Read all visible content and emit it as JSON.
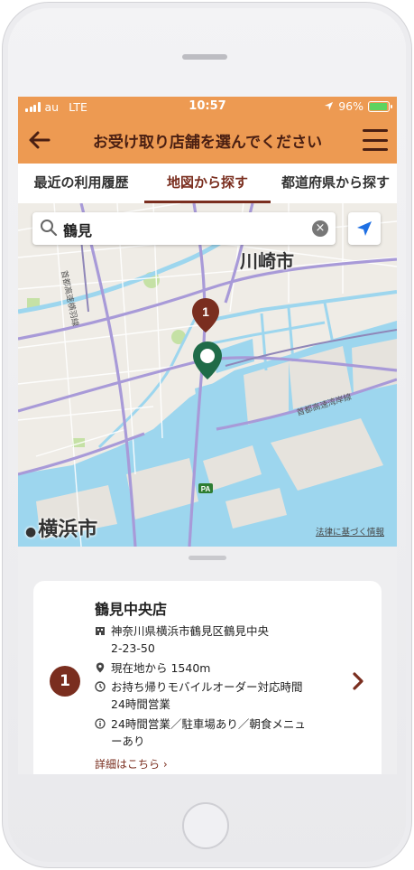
{
  "status_bar": {
    "carrier": "au",
    "network": "LTE",
    "time": "10:57",
    "battery": "96%",
    "battery_level": 0.96
  },
  "header": {
    "title": "お受け取り店舗を選んでください"
  },
  "tabs": [
    {
      "label": "最近の利用履歴",
      "active": false
    },
    {
      "label": "地図から探す",
      "active": true
    },
    {
      "label": "都道府県から探す",
      "active": false
    }
  ],
  "map": {
    "search_value": "鶴見",
    "labels": {
      "kawasaki": "川崎市",
      "yokohama": "横浜市",
      "expressway_1": "首都高速湾岸線",
      "expressway_2": "首都高速横羽線",
      "route_badge": "PA"
    },
    "legal_link": "法律に基づく情報",
    "store_pin_number": "1"
  },
  "store": {
    "number": "1",
    "name": "鶴見中央店",
    "address_line1": "神奈川県横浜市鶴見区鶴見中央",
    "address_line2": "2-23-50",
    "distance": "現在地から 1540m",
    "mobile_order_line1": "お持ち帰りモバイルオーダー対応時間",
    "mobile_order_line2": "24時間営業",
    "notes_line1": "24時間営業／駐車場あり／朝食メニュ",
    "notes_line2": "ーあり",
    "detail_link": "詳細はこちら ›"
  },
  "colors": {
    "accent": "#ed9a52",
    "brand_dark": "#7a2e1f",
    "pin_green": "#1f6b48",
    "sea": "#9dd6ee",
    "land": "#efece6"
  }
}
